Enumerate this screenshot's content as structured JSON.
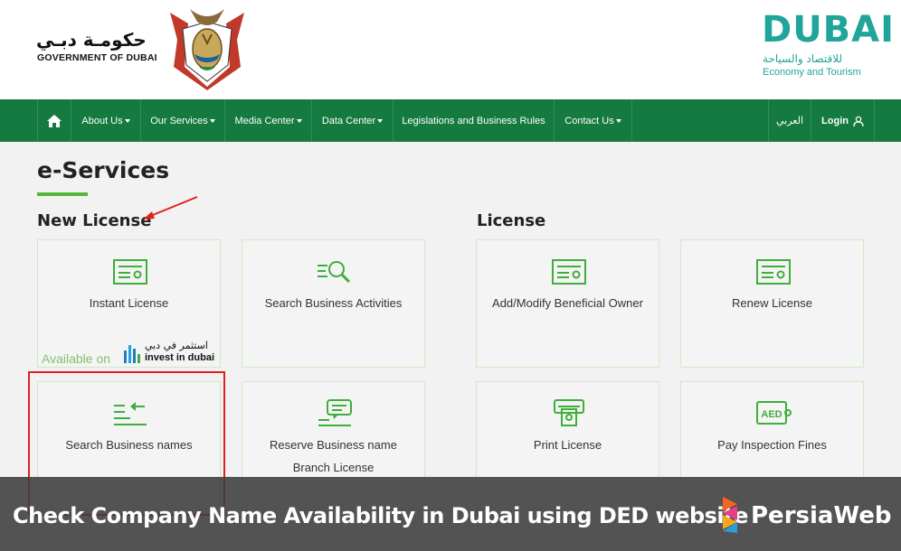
{
  "header": {
    "gov_ar": "حكومـة دبـي",
    "gov_en": "GOVERNMENT OF DUBAI",
    "dubai_word": "DUBAI",
    "dubai_ar": "للاقتصاد والسياحة",
    "dubai_en": "Economy and Tourism"
  },
  "nav": {
    "home_icon": "home-icon",
    "items": [
      "About Us",
      "Our Services",
      "Media Center",
      "Data Center",
      "Legislations and Business Rules",
      "Contact Us"
    ],
    "arabic": "العربي",
    "login": "Login",
    "color": "#147a3f"
  },
  "page": {
    "title": "e-Services",
    "new_license": "New License",
    "license": "License"
  },
  "cards": [
    {
      "label": "Instant License",
      "icon": "license-card-icon"
    },
    {
      "label": "Search Business Activities",
      "icon": "search-list-icon"
    },
    {
      "label": "Add/Modify Beneficial Owner",
      "icon": "license-card-icon"
    },
    {
      "label": "Renew License",
      "icon": "license-card-icon"
    },
    {
      "label": "Search Business names",
      "icon": "list-arrow-icon"
    },
    {
      "label": "Reserve Business name",
      "label2": "Branch License",
      "icon": "chat-list-icon"
    },
    {
      "label": "Print License",
      "icon": "printer-icon"
    },
    {
      "label": "Pay Inspection Fines",
      "icon": "aed-money-icon"
    }
  ],
  "invest": {
    "available": "Available on",
    "ar": "استثمر في دبي",
    "en": "invest in dubai"
  },
  "banner": {
    "text": "Check Company Name Availability in Dubai using DED website",
    "brand": "PersiaWeb"
  }
}
